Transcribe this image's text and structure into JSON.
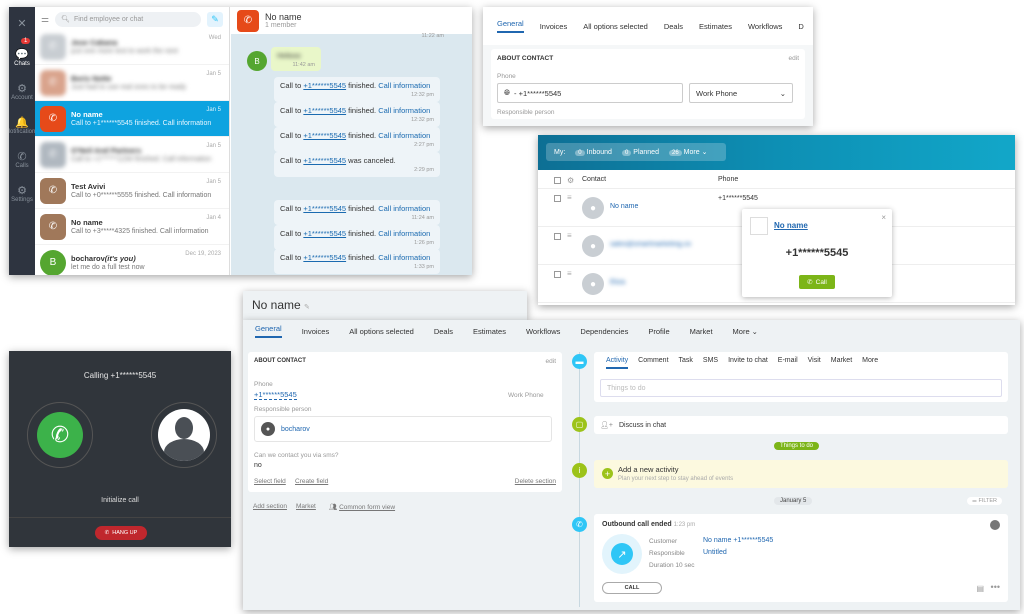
{
  "chat": {
    "rail": [
      {
        "icon": "close-icon",
        "glyph": "✕",
        "label": ""
      },
      {
        "icon": "chat-icon",
        "glyph": "💬",
        "label": "Chats",
        "badge": "1"
      },
      {
        "icon": "gear-icon",
        "glyph": "⚙",
        "label": "Account"
      },
      {
        "icon": "bell-icon",
        "glyph": "🔔",
        "label": "Notifications"
      },
      {
        "icon": "phone-icon",
        "glyph": "✆",
        "label": "Calls"
      },
      {
        "icon": "gear-icon",
        "glyph": "⚙",
        "label": "Settings"
      }
    ],
    "search_placeholder": "Find employee or chat",
    "items": [
      {
        "name": "Jose Cabana",
        "msg": "just one more test to work the next",
        "date": "Wed",
        "blurred": true,
        "avatar_color": "#c8cdd2"
      },
      {
        "name": "Boris Notte",
        "msg": "Just had to use real ones to be ready",
        "date": "Jan 5",
        "blurred": true,
        "avatar_color": "#d9a38c"
      },
      {
        "name": "No name",
        "msg": "Call to +1******5545 finished. Call information",
        "date": "Jan 5",
        "blurred": false,
        "selected": true,
        "avatar_color": "#e64a19"
      },
      {
        "name": "O'Neil And Partners",
        "msg": "Call to +1******1234 finished. Call information",
        "date": "Jan 5",
        "blurred": true,
        "avatar_color": "#b0b8c0"
      },
      {
        "name": "Test Avivi",
        "msg": "Call to +0******5555 finished. Call information",
        "date": "Jan 5",
        "blurred": false,
        "avatar_color": "#a0785a"
      },
      {
        "name": "No name",
        "msg": "Call to +3*****4325 finished. Call information",
        "date": "Jan 4",
        "blurred": false,
        "avatar_color": "#a0785a"
      },
      {
        "name": "bocharov",
        "name_suffix": "(it's you)",
        "msg": "let me do a full test now",
        "date": "Dec 19, 2023",
        "blurred": false,
        "avatar_color": "#55a630",
        "avatar_letter": "B"
      }
    ],
    "header": {
      "name": "No name",
      "sub": "1 member"
    },
    "messages": [
      {
        "prefix": "Call to ",
        "num": "+1******5545",
        "suffix": " finished. ",
        "link": "Call information",
        "time": "12:32 pm"
      },
      {
        "prefix": "Call to ",
        "num": "+1******5545",
        "suffix": " finished. ",
        "link": "Call information",
        "time": "12:32 pm"
      },
      {
        "prefix": "Call to ",
        "num": "+1******5545",
        "suffix": " finished. ",
        "link": "Call information",
        "time": "2:27 pm"
      },
      {
        "prefix": "Call to ",
        "num": "+1******5545",
        "suffix": " was canceled.",
        "link": "",
        "time": "2:29 pm"
      },
      {
        "prefix": "Call to ",
        "num": "+1******5545",
        "suffix": " finished. ",
        "link": "Call information",
        "time": "11:24 am"
      },
      {
        "prefix": "Call to ",
        "num": "+1******5545",
        "suffix": " finished. ",
        "link": "Call information",
        "time": "1:26 pm"
      },
      {
        "prefix": "Call to ",
        "num": "+1******5545",
        "suffix": " finished. ",
        "link": "Call information",
        "time": "1:33 pm"
      }
    ],
    "top_time": "11:22 am",
    "green_bubble_time": "11:42 am",
    "green_avatar": "B"
  },
  "tabs_panel": {
    "tabs": [
      "General",
      "Invoices",
      "All options selected",
      "Deals",
      "Estimates",
      "Workflows",
      "D"
    ],
    "section": "ABOUT CONTACT",
    "edit": "edit",
    "phone_label": "Phone",
    "phone_value": "+1******5545",
    "phone_type": "Work Phone",
    "responsible": "Responsible person"
  },
  "list_panel": {
    "my": "My:",
    "filters": [
      {
        "count": "0",
        "label": "Inbound"
      },
      {
        "count": "0",
        "label": "Planned"
      },
      {
        "count": "26",
        "label": "More"
      }
    ],
    "col_contact": "Contact",
    "col_phone": "Phone",
    "rows": [
      {
        "name": "No name",
        "phone": "+1******5545",
        "blurred": false
      },
      {
        "name": "sales@smartmarketing.co",
        "phone": "",
        "blurred": true
      },
      {
        "name": "Eliza",
        "phone": "",
        "blurred": true
      }
    ],
    "popup": {
      "name": "No name",
      "number": "+1******5545",
      "button": "Call"
    }
  },
  "call_panel": {
    "title": "Calling +1******5545",
    "status": "Initialize call",
    "hangup": "HANG UP"
  },
  "detail": {
    "title": "No name",
    "tabs": [
      "General",
      "Invoices",
      "All options selected",
      "Deals",
      "Estimates",
      "Workflows",
      "Dependencies",
      "Profile",
      "Market",
      "More"
    ],
    "section": "ABOUT CONTACT",
    "edit": "edit",
    "phone_label": "Phone",
    "phone_value": "+1******5545",
    "phone_type": "Work Phone",
    "responsible_label": "Responsible person",
    "responsible_name": "bocharov",
    "sms_label": "Can we contact you via sms?",
    "sms_value": "no",
    "select_field": "Select field",
    "create_field": "Create field",
    "delete_section": "Delete section",
    "add_section": "Add section",
    "market": "Market",
    "common_form": "Common form view",
    "activity_tabs": [
      "Activity",
      "Comment",
      "Task",
      "SMS",
      "Invite to chat",
      "E-mail",
      "Visit",
      "Market",
      "More"
    ],
    "things_placeholder": "Things to do",
    "discuss": "Discuss in chat",
    "things_pill": "Things to do",
    "add_activity": "Add a new activity",
    "add_activity_sub": "Plan your next step to stay ahead of events",
    "date_pill": "January 5",
    "filter": "FILTER",
    "call_title": "Outbound call ended",
    "call_time": "1:23 pm",
    "customer_label": "Customer",
    "customer_value": "No name +1******5545",
    "responsible2_label": "Responsible",
    "responsible2_value": "Untitled",
    "duration": "Duration 10 sec",
    "call_button": "CALL"
  }
}
